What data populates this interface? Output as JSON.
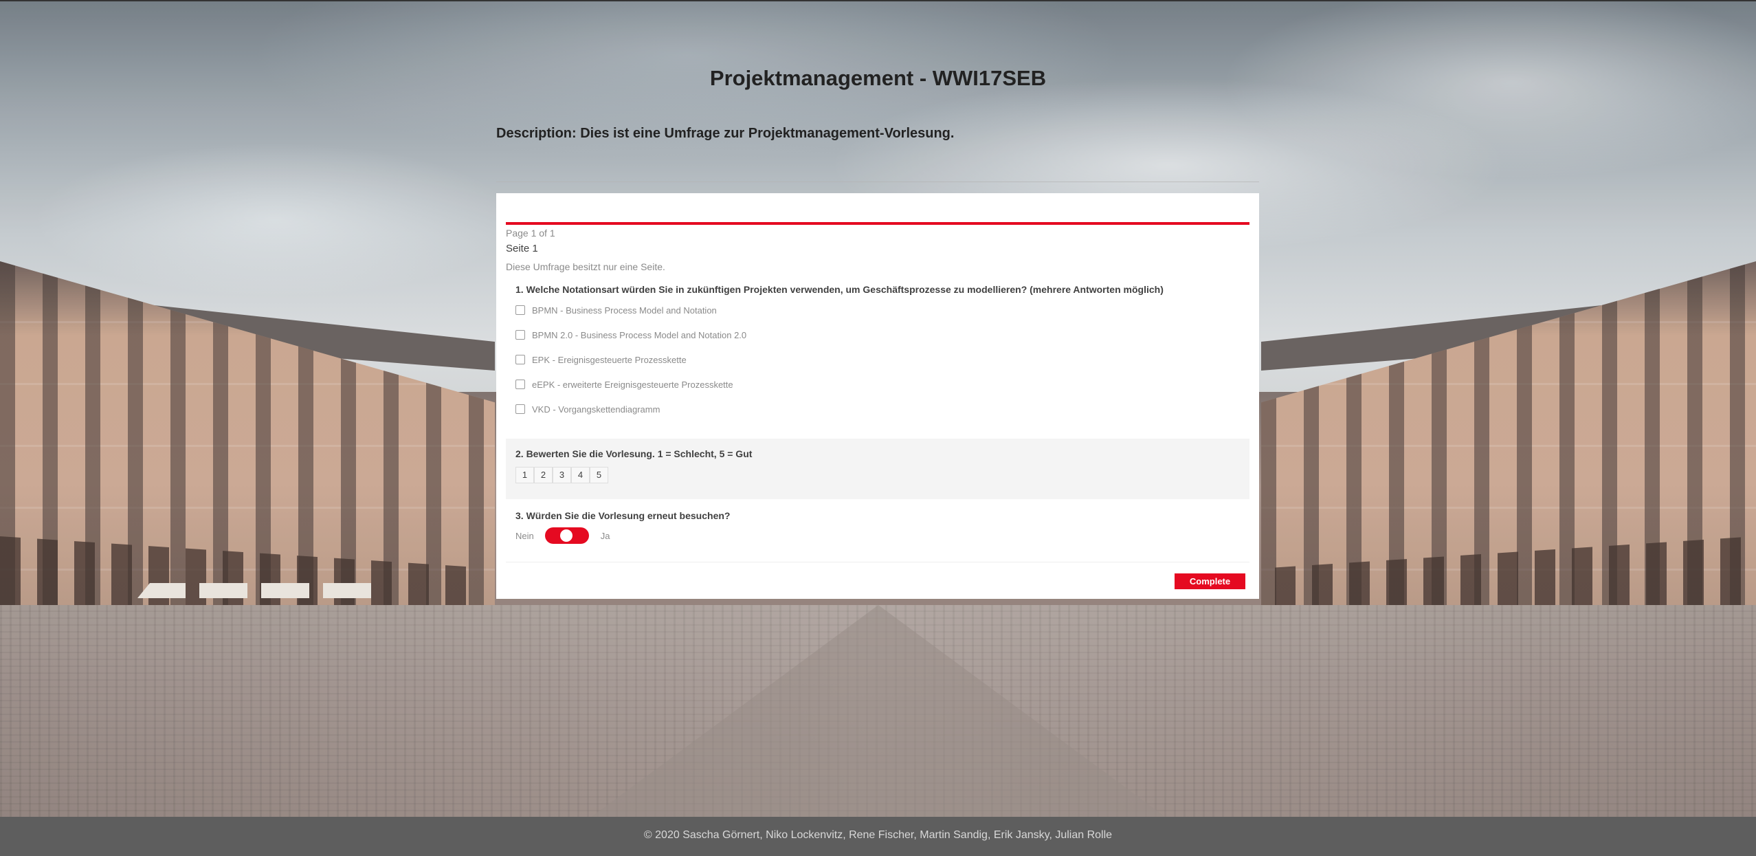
{
  "header": {
    "title": "Projektmanagement - WWI17SEB",
    "description": "Description: Dies ist eine Umfrage zur Projektmanagement-Vorlesung."
  },
  "survey": {
    "progress_text": "Page 1 of 1",
    "progress_fraction": 1.0,
    "page_title": "Seite 1",
    "page_description": "Diese Umfrage besitzt nur eine Seite.",
    "questions": [
      {
        "title": "1. Welche Notationsart würden Sie in zukünftigen Projekten verwenden, um Geschäftsprozesse zu modellieren? (mehrere Antworten möglich)",
        "options": [
          "BPMN - Business Process Model and Notation",
          "BPMN 2.0 - Business Process Model and Notation 2.0",
          "EPK - Ereignisgesteuerte Prozesskette",
          "eEPK - erweiterte Ereignisgesteuerte Prozesskette",
          "VKD - Vorgangskettendiagramm"
        ]
      },
      {
        "title": "2. Bewerten Sie die Vorlesung. 1 = Schlecht, 5 = Gut",
        "rating": [
          "1",
          "2",
          "3",
          "4",
          "5"
        ]
      },
      {
        "title": "3. Würden Sie die Vorlesung erneut besuchen?",
        "false_label": "Nein",
        "true_label": "Ja",
        "value": "Ja"
      }
    ],
    "complete_label": "Complete"
  },
  "footer": {
    "text": "© 2020 Sascha Görnert, Niko Lockenvitz, Rene Fischer, Martin Sandig, Erik Jansky, Julian Rolle"
  },
  "colors": {
    "accent": "#e50a21",
    "footer_bg": "#5e5e5e",
    "text_dark": "#222222"
  }
}
